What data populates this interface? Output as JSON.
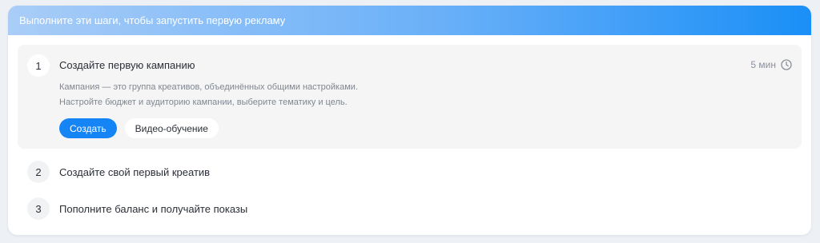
{
  "header": {
    "title": "Выполните эти шаги, чтобы запустить первую рекламу"
  },
  "steps": [
    {
      "number": "1",
      "title": "Создайте первую кампанию",
      "time": "5 мин",
      "description_line1": "Кампания — это группа креативов, объединённых общими настройками.",
      "description_line2": "Настройте бюджет и аудиторию кампании, выберите тематику и цель.",
      "primary_button": "Создать",
      "secondary_button": "Видео-обучение"
    },
    {
      "number": "2",
      "title": "Создайте свой первый креатив"
    },
    {
      "number": "3",
      "title": "Пополните баланс и получайте показы"
    }
  ],
  "colors": {
    "accent": "#1585f5",
    "header_gradient_start": "#a9cdf7",
    "header_gradient_end": "#1a8ff7"
  },
  "icons": {
    "time": "clock-icon"
  }
}
